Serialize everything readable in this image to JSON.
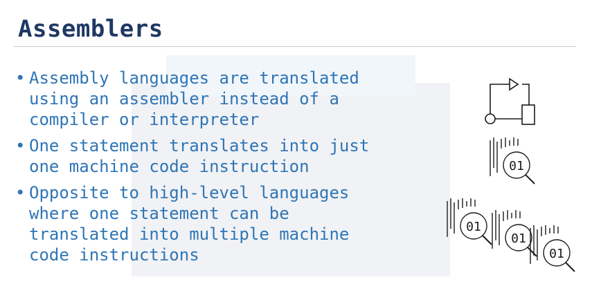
{
  "slide": {
    "title": "Assemblers",
    "bullets": [
      {
        "text": "Assembly languages are translated\nusing an assembler instead of a\ncompiler or interpreter"
      },
      {
        "text": "One statement translates into just\none machine code instruction"
      },
      {
        "text": "Opposite to high-level languages\nwhere one statement can be\ntranslated into multiple machine\ncode instructions"
      }
    ],
    "bullet_glyph": "•",
    "icons": [
      {
        "name": "flowchart-icon"
      },
      {
        "name": "binary-search-icon",
        "label": "01"
      },
      {
        "name": "binary-search-icon",
        "label": "01"
      },
      {
        "name": "binary-search-icon",
        "label": "01"
      },
      {
        "name": "binary-search-icon",
        "label": "01"
      }
    ]
  },
  "colors": {
    "title": "#1f3864",
    "bullet_text": "#2e75b6",
    "rule": "#c8c8c8",
    "icon_stroke": "#1a1a1a"
  }
}
